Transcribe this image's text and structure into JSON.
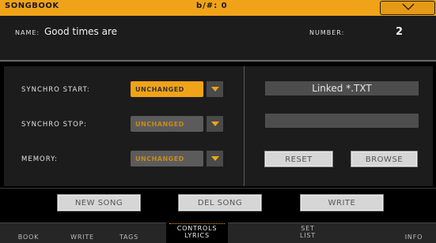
{
  "topbar": {
    "title": "SONGBOOK",
    "transpose": "b/#: 0"
  },
  "header": {
    "name_label": "NAME:",
    "name_value": "Good times are",
    "number_label": "NUMBER:",
    "number_value": "2"
  },
  "left_panel": {
    "rows": [
      {
        "label": "SYNCHRO START:",
        "value": "UNCHANGED",
        "state": "active"
      },
      {
        "label": "SYNCHRO STOP:",
        "value": "UNCHANGED",
        "state": "inactive"
      },
      {
        "label": "MEMORY:",
        "value": "UNCHANGED",
        "state": "inactive"
      }
    ]
  },
  "right_panel": {
    "linked_label": "Linked *.TXT",
    "path_value": "",
    "reset_label": "RESET",
    "browse_label": "BROWSE"
  },
  "actions": {
    "new_song": "NEW SONG",
    "del_song": "DEL SONG",
    "write": "WRITE"
  },
  "tabs": [
    {
      "label": "BOOK"
    },
    {
      "label": "WRITE"
    },
    {
      "label": "TAGS"
    },
    {
      "label": "CONTROLS LYRICS",
      "line1": "CONTROLS",
      "line2": "LYRICS",
      "active": true
    },
    {
      "label": "SET LIST",
      "line1": "SET",
      "line2": "LIST"
    },
    {
      "label": "INFO"
    }
  ],
  "colors": {
    "accent": "#f0a318",
    "panel": "#1c1c1c",
    "button": "#d6d6d6"
  },
  "icons": {
    "menu": "chevron-down-icon",
    "dropdown": "triangle-down-icon"
  }
}
